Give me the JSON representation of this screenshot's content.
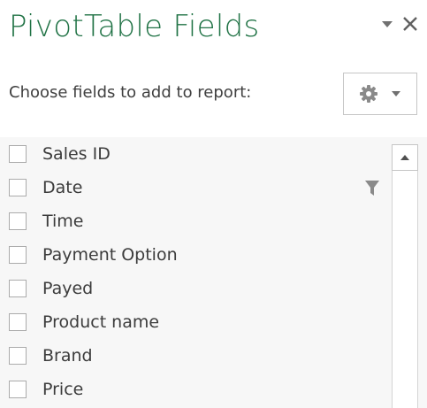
{
  "pane": {
    "title": "PivotTable Fields",
    "subtitle": "Choose fields to add to report:",
    "dropdown_icon": "triangle-down-icon",
    "close_icon": "close-icon",
    "tools_icon": "gear-icon",
    "accent_color": "#217346"
  },
  "fields": [
    {
      "label": "Sales ID",
      "checked": false
    },
    {
      "label": "Date",
      "checked": false,
      "filtered": true
    },
    {
      "label": "Time",
      "checked": false
    },
    {
      "label": "Payment Option",
      "checked": false
    },
    {
      "label": "Payed",
      "checked": false
    },
    {
      "label": "Product name",
      "checked": false
    },
    {
      "label": "Brand",
      "checked": false
    },
    {
      "label": "Price",
      "checked": false
    }
  ]
}
